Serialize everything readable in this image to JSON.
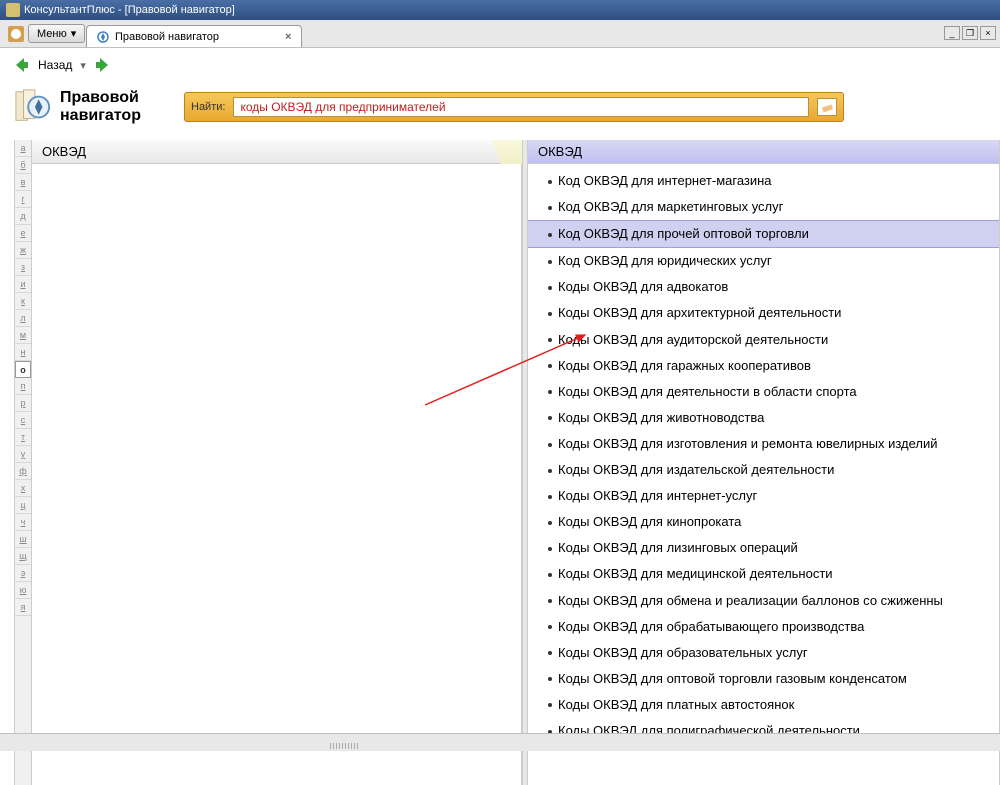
{
  "titlebar": {
    "text": "КонсультантПлюс - [Правовой навигатор]"
  },
  "toolbar": {
    "menu_label": "Меню"
  },
  "tab": {
    "label": "Правовой навигатор"
  },
  "nav": {
    "back_label": "Назад"
  },
  "header": {
    "title_line1": "Правовой",
    "title_line2": "навигатор",
    "search_label": "Найти:",
    "search_value": "коды ОКВЭД для предпринимателей"
  },
  "alpha": [
    "а",
    "б",
    "в",
    "г",
    "д",
    "е",
    "ж",
    "з",
    "и",
    "к",
    "л",
    "м",
    "н",
    "о",
    "п",
    "р",
    "с",
    "т",
    "у",
    "ф",
    "х",
    "ц",
    "ч",
    "ш",
    "щ",
    "э",
    "ю",
    "я"
  ],
  "alpha_active": "о",
  "left_pane": {
    "header": "ОКВЭД"
  },
  "right_pane": {
    "header": "ОКВЭД",
    "selected_index": 2,
    "items": [
      "Код ОКВЭД для интернет-магазина",
      "Код ОКВЭД для маркетинговых услуг",
      "Код ОКВЭД для прочей оптовой торговли",
      "Код ОКВЭД для юридических услуг",
      "Коды ОКВЭД для адвокатов",
      "Коды ОКВЭД для архитектурной деятельности",
      "Коды ОКВЭД для аудиторской деятельности",
      "Коды ОКВЭД для гаражных кооперативов",
      "Коды ОКВЭД для деятельности в области спорта",
      "Коды ОКВЭД для животноводства",
      "Коды ОКВЭД для изготовления и ремонта ювелирных изделий",
      "Коды ОКВЭД для издательской деятельности",
      "Коды ОКВЭД для интернет-услуг",
      "Коды ОКВЭД для кинопроката",
      "Коды ОКВЭД для лизинговых операций",
      "Коды ОКВЭД для медицинской деятельности",
      "Коды ОКВЭД для обмена и реализации баллонов со сжиженны",
      "Коды ОКВЭД для обрабатывающего производства",
      "Коды ОКВЭД для образовательных услуг",
      "Коды ОКВЭД для оптовой торговли газовым конденсатом",
      "Коды ОКВЭД для платных автостоянок",
      "Коды ОКВЭД для полиграфической деятельности"
    ]
  }
}
